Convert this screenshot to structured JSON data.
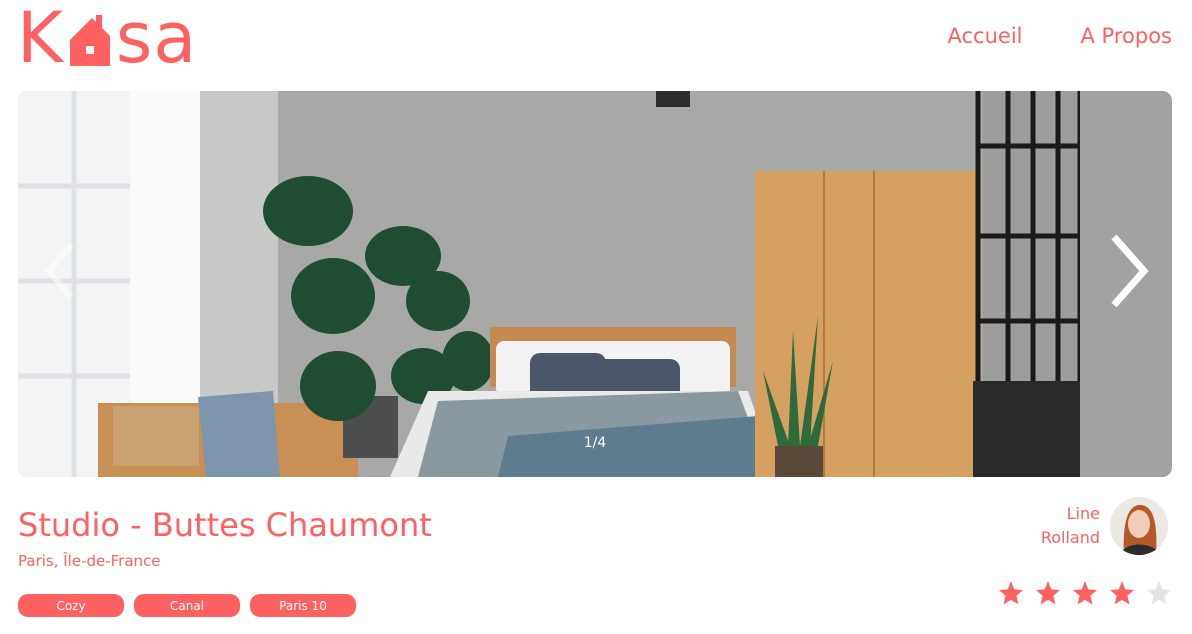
{
  "brand": {
    "logo_left": "K",
    "logo_right": "sa",
    "logo_icon": "house-icon"
  },
  "nav": {
    "items": [
      {
        "label": "Accueil"
      },
      {
        "label": "A Propos"
      }
    ]
  },
  "carousel": {
    "counter": "1/4",
    "prev_icon": "chevron-left-icon",
    "next_icon": "chevron-right-icon"
  },
  "listing": {
    "title": "Studio - Buttes Chaumont",
    "location": "Paris, Île-de-France",
    "tags": [
      {
        "label": "Cozy"
      },
      {
        "label": "Canal"
      },
      {
        "label": "Paris 10"
      }
    ]
  },
  "host": {
    "first_name": "Line",
    "last_name": "Rolland"
  },
  "rating": {
    "value": 4,
    "max": 5
  },
  "colors": {
    "accent": "#FF6060",
    "star_inactive": "#E3E3E3",
    "tag_text": "#FFFFFF"
  }
}
